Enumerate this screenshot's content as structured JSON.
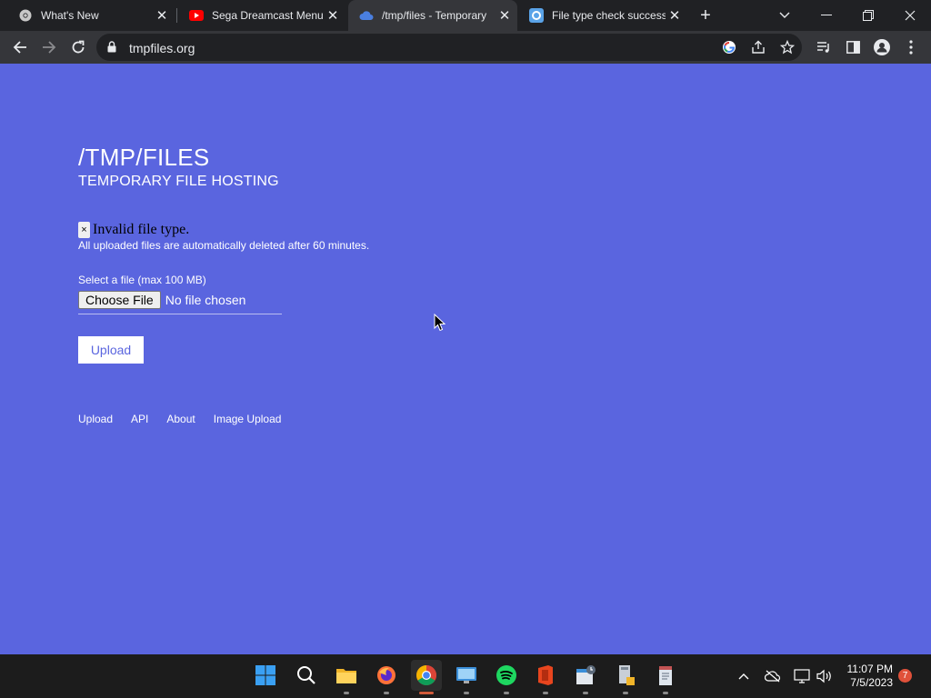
{
  "browser": {
    "tabs": [
      {
        "title": "What's New",
        "icon": "chrome-icon",
        "active": false
      },
      {
        "title": "Sega Dreamcast Menu",
        "icon": "youtube-icon",
        "active": false
      },
      {
        "title": "/tmp/files - Temporary",
        "icon": "cloud-icon",
        "active": true
      },
      {
        "title": "File type check success",
        "icon": "globe-icon",
        "active": false
      }
    ],
    "tab_close_glyph": "✕",
    "new_tab_glyph": "+",
    "url": "tmpfiles.org"
  },
  "page": {
    "title": "/TMP/FILES",
    "subtitle": "TEMPORARY FILE HOSTING",
    "error_close_glyph": "×",
    "error_message": "Invalid file type.",
    "notice": "All uploaded files are automatically deleted after 60 minutes.",
    "file_label": "Select a file (max 100 MB)",
    "choose_file_label": "Choose File",
    "no_file_text": "No file chosen",
    "upload_button": "Upload",
    "footer_links": [
      "Upload",
      "API",
      "About",
      "Image Upload"
    ],
    "background_color": "#5a65df"
  },
  "taskbar": {
    "apps": [
      "windows-start",
      "search",
      "file-explorer",
      "firefox",
      "chrome",
      "remote-desktop",
      "spotify",
      "office",
      "calendar-app",
      "app-installer",
      "notepad-app"
    ],
    "time": "11:07 PM",
    "date": "7/5/2023",
    "notification_count": "7"
  }
}
